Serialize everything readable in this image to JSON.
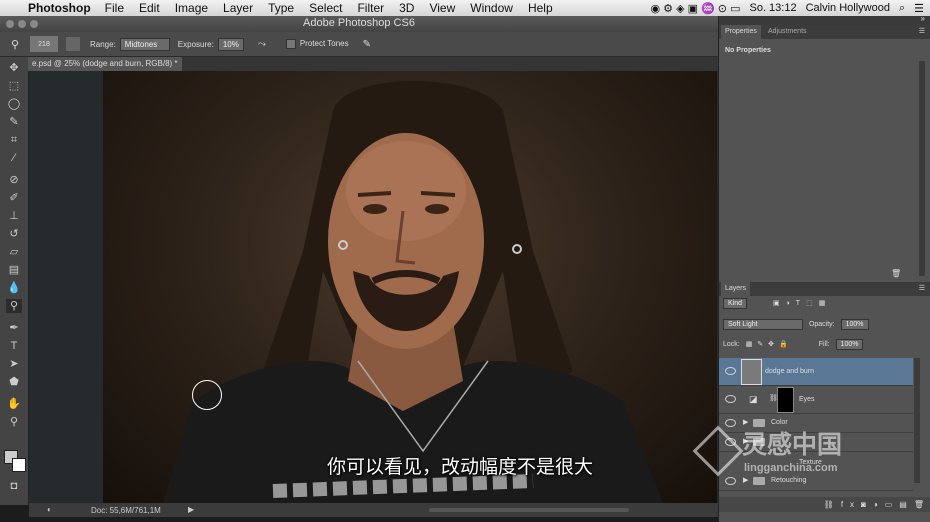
{
  "menubar": {
    "app": "Photoshop",
    "items": [
      "File",
      "Edit",
      "Image",
      "Layer",
      "Type",
      "Select",
      "Filter",
      "3D",
      "View",
      "Window",
      "Help"
    ],
    "clock": "So. 13:12",
    "user": "Calvin Hollywood"
  },
  "window": {
    "title": "Adobe Photoshop CS6"
  },
  "options": {
    "brush_size": "218",
    "range_label": "Range:",
    "range_value": "Midtones",
    "exposure_label": "Exposure:",
    "exposure_value": "10%",
    "protect_tones": "Protect Tones"
  },
  "document": {
    "tab": "e.psd @ 25% (dodge and burn, RGB/8) *",
    "status": "Doc: 55,6M/761,1M"
  },
  "panels": {
    "properties_tab": "Properties",
    "adjustments_tab": "Adjustments",
    "no_properties": "No Properties",
    "layers_tab": "Layers",
    "kind": "Kind",
    "blend_mode": "Soft Light",
    "opacity_label": "Opacity:",
    "opacity_value": "100%",
    "lock_label": "Lock:",
    "fill_label": "Fill:",
    "fill_value": "100%",
    "layers": [
      "dodge and burn",
      "Eyes",
      "Color",
      "Texture",
      "Retouching"
    ]
  },
  "subtitle": "你可以看见，改动幅度不是很大",
  "watermark": {
    "brand": "灵感中国",
    "site": "lingganchina.com"
  },
  "colors": {
    "selected_layer": "#5a7896",
    "panel": "#535353",
    "toolbar": "#444444"
  }
}
